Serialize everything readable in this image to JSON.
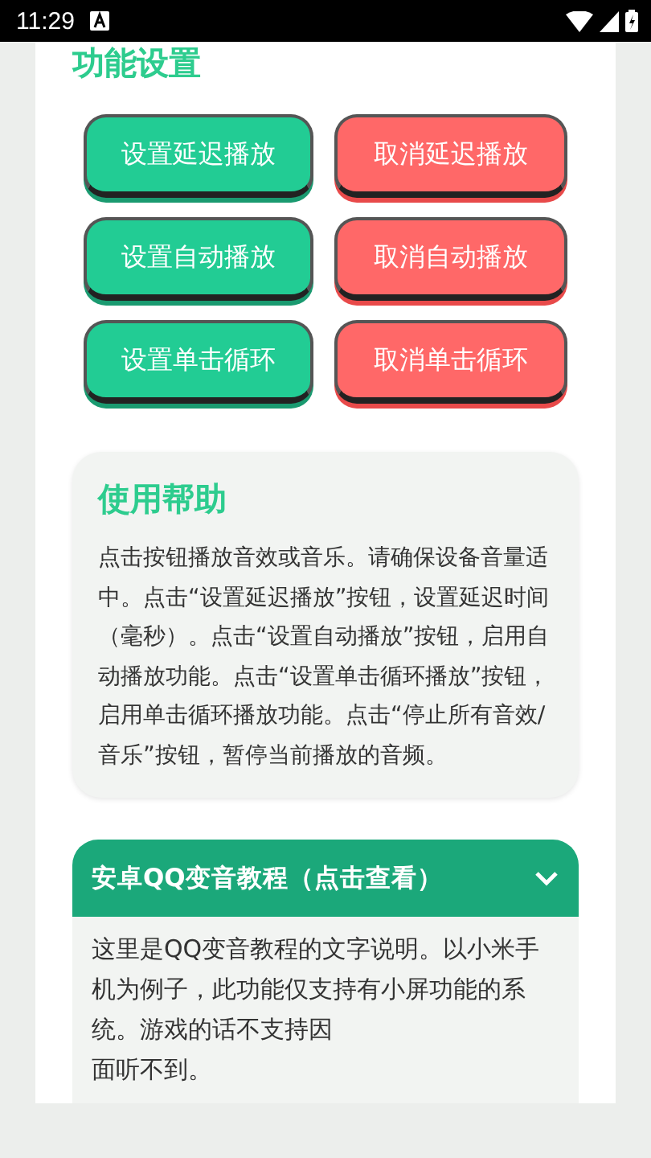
{
  "status_bar": {
    "time": "11:29"
  },
  "section": {
    "title": "功能设置"
  },
  "buttons": [
    {
      "label": "设置延迟播放",
      "kind": "set"
    },
    {
      "label": "取消延迟播放",
      "kind": "cancel"
    },
    {
      "label": "设置自动播放",
      "kind": "set"
    },
    {
      "label": "取消自动播放",
      "kind": "cancel"
    },
    {
      "label": "设置单击循环",
      "kind": "set"
    },
    {
      "label": "取消单击循环",
      "kind": "cancel"
    }
  ],
  "help": {
    "title": "使用帮助",
    "text": "点击按钮播放音效或音乐。请确保设备音量适中。点击“设置延迟播放”按钮，设置延迟时间（毫秒）。点击“设置自动播放”按钮，启用自动播放功能。点击“设置单击循环播放”按钮，启用单击循环播放功能。点击“停止所有音效/音乐”按钮，暂停当前播放的音频。"
  },
  "tutorial": {
    "title": "安卓QQ变音教程（点击查看）",
    "expanded": true,
    "lines": [
      "这里是QQ变音教程的文字说明。以小米手",
      "机为例子，此功能仅支持有小屏功能的系",
      "统。游戏的话不支持因",
      "面听不到。"
    ]
  }
}
